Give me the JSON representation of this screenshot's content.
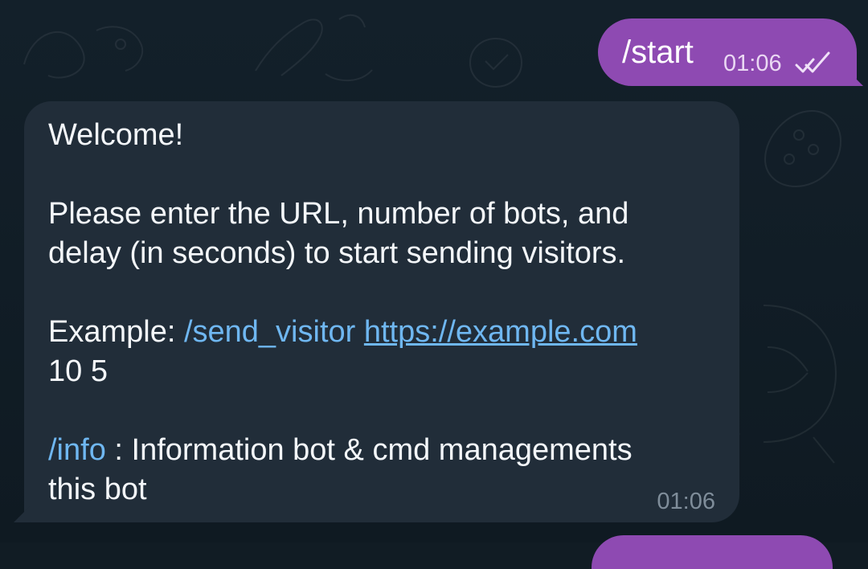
{
  "chat": {
    "outgoing": {
      "text": "/start",
      "time": "01:06",
      "status_icon": "double-check-icon"
    },
    "incoming": {
      "welcome": "Welcome!",
      "line1": "Please enter the URL, number of bots, and",
      "line2": "delay (in seconds) to start sending visitors.",
      "example_label": "Example:",
      "example_command": "/send_visitor",
      "example_url": "https://example.com",
      "example_values": "10 5",
      "info_command": "/info",
      "info_text": ": Information bot & cmd managements",
      "info_text_2": "this bot",
      "time": "01:06"
    }
  }
}
